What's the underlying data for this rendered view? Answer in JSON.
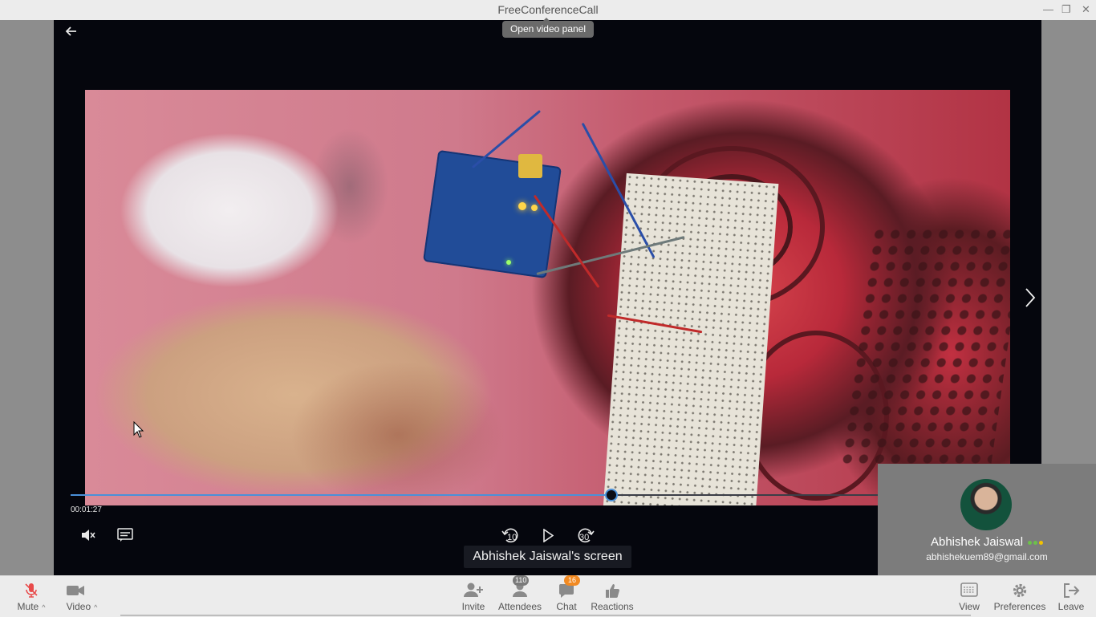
{
  "window": {
    "title": "FreeConferenceCall",
    "controls": [
      "minimize",
      "restore",
      "close"
    ]
  },
  "stage": {
    "tooltip": "Open video panel",
    "back_icon": "arrow-left-icon",
    "next_icon": "chevron-right-icon"
  },
  "player": {
    "time": "00:01:27",
    "progress": 0.67,
    "rewind_label": "10",
    "forward_label": "30",
    "icons": [
      "mute-volume-icon",
      "captions-icon",
      "rewind-10-icon",
      "play-icon",
      "forward-30-icon"
    ]
  },
  "screen_label": "Abhishek Jaiswal's screen",
  "participant": {
    "name": "Abhishek Jaiswal",
    "email": "abhishekuem89@gmail.com",
    "status_colors": [
      "#6cc24a",
      "#6cc24a",
      "#f2c200"
    ]
  },
  "toolbar": {
    "mute": "Mute",
    "video": "Video",
    "invite": "Invite",
    "attendees": "Attendees",
    "attendees_count": "110",
    "chat": "Chat",
    "chat_count": "16",
    "reactions": "Reactions",
    "view": "View",
    "preferences": "Preferences",
    "leave": "Leave"
  },
  "colors": {
    "accent": "#4a90d9",
    "mute_red": "#e84b4b",
    "chat_badge": "#f28a22"
  }
}
